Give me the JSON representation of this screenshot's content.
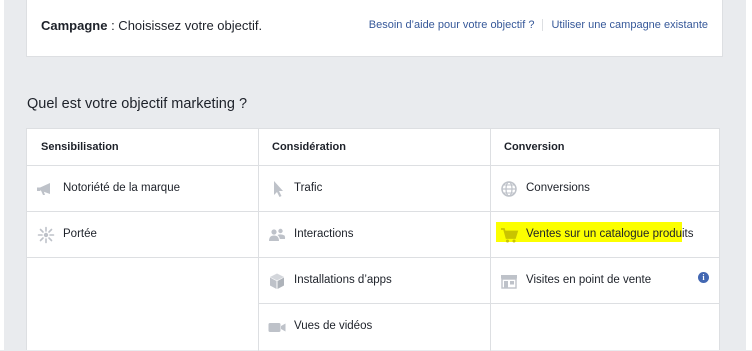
{
  "header": {
    "campaign_label": "Campagne",
    "campaign_text": " : Choisissez votre objectif.",
    "help_link": "Besoin d’aide pour votre objectif ?",
    "existing_link": "Utiliser une campagne existante"
  },
  "main": {
    "heading": "Quel est votre objectif marketing ?",
    "columns": [
      {
        "title": "Sensibilisation",
        "items": [
          {
            "label": "Notoriété de la marque",
            "icon": "megaphone-icon"
          },
          {
            "label": "Portée",
            "icon": "burst-icon"
          }
        ]
      },
      {
        "title": "Considération",
        "items": [
          {
            "label": "Trafic",
            "icon": "cursor-icon"
          },
          {
            "label": "Interactions",
            "icon": "people-icon"
          },
          {
            "label": "Installations d’apps",
            "icon": "box-icon"
          },
          {
            "label": "Vues de vidéos",
            "icon": "video-camera-icon"
          }
        ]
      },
      {
        "title": "Conversion",
        "items": [
          {
            "label": "Conversions",
            "icon": "globe-icon"
          },
          {
            "label": "Ventes sur un catalogue produits",
            "icon": "shopping-cart-icon",
            "highlighted": true
          },
          {
            "label": "Visites en point de vente",
            "icon": "storefront-icon",
            "info": "i"
          }
        ]
      }
    ]
  },
  "colors": {
    "link": "#365899",
    "highlight": "#fcff00",
    "icon": "#bec2c9",
    "info": "#4267b2"
  }
}
